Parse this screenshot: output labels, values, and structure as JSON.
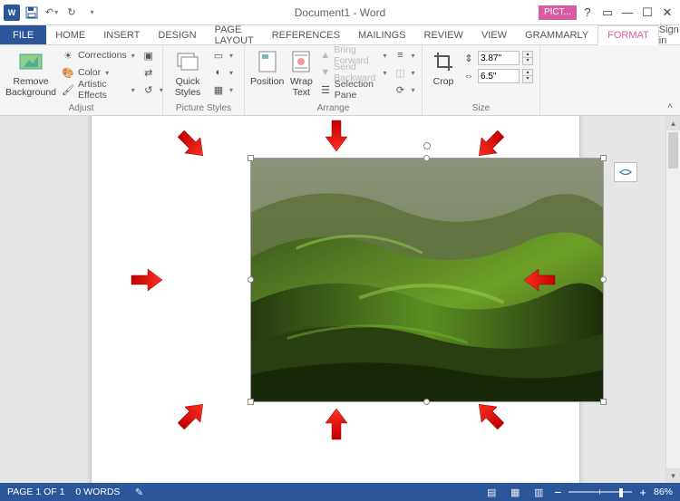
{
  "title": "Document1 - Word",
  "context_tab": "PICT...",
  "help_icon": "?",
  "signin": "Sign in",
  "tabs": {
    "file": "FILE",
    "home": "HOME",
    "insert": "INSERT",
    "design": "DESIGN",
    "page_layout": "PAGE LAYOUT",
    "references": "REFERENCES",
    "mailings": "MAILINGS",
    "review": "REVIEW",
    "view": "VIEW",
    "grammarly": "GRAMMARLY",
    "format": "FORMAT"
  },
  "ribbon": {
    "adjust": {
      "label": "Adjust",
      "remove_background": "Remove Background",
      "corrections": "Corrections",
      "color": "Color",
      "artistic_effects": "Artistic Effects"
    },
    "picture_styles": {
      "label": "Picture Styles",
      "quick_styles": "Quick Styles"
    },
    "arrange": {
      "label": "Arrange",
      "position": "Position",
      "wrap_text": "Wrap Text",
      "bring_forward": "Bring Forward",
      "send_backward": "Send Backward",
      "selection_pane": "Selection Pane"
    },
    "size": {
      "label": "Size",
      "crop": "Crop",
      "height": "3.87\"",
      "width": "6.5\""
    }
  },
  "status": {
    "page": "PAGE 1 OF 1",
    "words": "0 WORDS",
    "zoom_minus": "−",
    "zoom_plus": "+",
    "zoom": "86%"
  }
}
